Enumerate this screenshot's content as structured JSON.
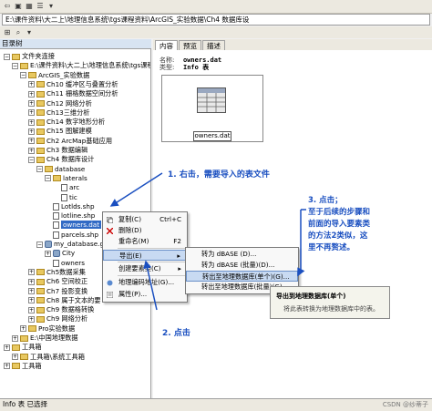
{
  "address": {
    "path": "E:\\课件资料\\大二上\\地理信息系统\\tgs课程资料\\ArcGIS_实验数据\\Ch4 数据库设"
  },
  "tree": {
    "title": "目录树",
    "items": [
      {
        "label": "文件夹连接",
        "indent": 0,
        "icon": "folder",
        "exp": "−"
      },
      {
        "label": "E:\\课件资料\\大二上\\地理信息系统\\tgs课程资",
        "indent": 1,
        "icon": "folder",
        "exp": "−"
      },
      {
        "label": "ArcGIS_实验数据",
        "indent": 2,
        "icon": "folder",
        "exp": "−"
      },
      {
        "label": "Ch10 缓冲区与叠置分析",
        "indent": 3,
        "icon": "folder",
        "exp": "+"
      },
      {
        "label": "Ch11 栅格数据空间分析",
        "indent": 3,
        "icon": "folder",
        "exp": "+"
      },
      {
        "label": "Ch12 网络分析",
        "indent": 3,
        "icon": "folder",
        "exp": "+"
      },
      {
        "label": "Ch13三维分析",
        "indent": 3,
        "icon": "folder",
        "exp": "+"
      },
      {
        "label": "Ch14 数字地形分析",
        "indent": 3,
        "icon": "folder",
        "exp": "+"
      },
      {
        "label": "Ch15 图解建模",
        "indent": 3,
        "icon": "folder",
        "exp": "+"
      },
      {
        "label": "Ch2 ArcMap基础应用",
        "indent": 3,
        "icon": "folder",
        "exp": "+"
      },
      {
        "label": "Ch3 数据编辑",
        "indent": 3,
        "icon": "folder",
        "exp": "+"
      },
      {
        "label": "Ch4 数据库设计",
        "indent": 3,
        "icon": "folder",
        "exp": "−"
      },
      {
        "label": "database",
        "indent": 4,
        "icon": "folder",
        "exp": "−"
      },
      {
        "label": "laterals",
        "indent": 5,
        "icon": "folder",
        "exp": "−"
      },
      {
        "label": "arc",
        "indent": 6,
        "icon": "file",
        "exp": ""
      },
      {
        "label": "tic",
        "indent": 6,
        "icon": "file",
        "exp": ""
      },
      {
        "label": "Lotlds.shp",
        "indent": 5,
        "icon": "file",
        "exp": ""
      },
      {
        "label": "lotline.shp",
        "indent": 5,
        "icon": "file",
        "exp": ""
      },
      {
        "label": "owners.dat",
        "indent": 5,
        "icon": "file",
        "exp": "",
        "selected": true
      },
      {
        "label": "parcels.shp",
        "indent": 5,
        "icon": "file",
        "exp": ""
      },
      {
        "label": "my_database.gdb",
        "indent": 4,
        "icon": "db",
        "exp": "−"
      },
      {
        "label": "City",
        "indent": 5,
        "icon": "db",
        "exp": "+"
      },
      {
        "label": "owners",
        "indent": 5,
        "icon": "file",
        "exp": ""
      },
      {
        "label": "Ch5数据采集",
        "indent": 3,
        "icon": "folder",
        "exp": "+"
      },
      {
        "label": "Ch6 空间校正",
        "indent": 3,
        "icon": "folder",
        "exp": "+"
      },
      {
        "label": "Ch7 投影变换",
        "indent": 3,
        "icon": "folder",
        "exp": "+"
      },
      {
        "label": "Ch8 属于文本的要",
        "indent": 3,
        "icon": "folder",
        "exp": "+"
      },
      {
        "label": "Ch9 数据格转换",
        "indent": 3,
        "icon": "folder",
        "exp": "+"
      },
      {
        "label": "Ch9 网络分析",
        "indent": 3,
        "icon": "folder",
        "exp": "+"
      },
      {
        "label": "Pro实验数据",
        "indent": 2,
        "icon": "folder",
        "exp": "+"
      },
      {
        "label": "E:\\中国地理数据",
        "indent": 1,
        "icon": "folder",
        "exp": "+"
      },
      {
        "label": "工具箱",
        "indent": 0,
        "icon": "folder",
        "exp": "+"
      },
      {
        "label": "工具箱\\系统工具箱",
        "indent": 1,
        "icon": "folder",
        "exp": "+"
      },
      {
        "label": "工具箱",
        "indent": 0,
        "icon": "folder",
        "exp": "+"
      }
    ]
  },
  "tabs": [
    {
      "label": "内容",
      "active": true
    },
    {
      "label": "预览",
      "active": false
    },
    {
      "label": "描述",
      "active": false
    }
  ],
  "content": {
    "name_label": "名称:",
    "name_value": "owners.dat",
    "type_label": "类型:",
    "type_value": "Info 表",
    "preview_caption": "owners.dat"
  },
  "context_menu": [
    {
      "label": "复制(C)",
      "shortcut": "Ctrl+C",
      "icon": "copy-icon"
    },
    {
      "label": "删除(D)",
      "shortcut": "",
      "icon": "delete-icon"
    },
    {
      "label": "重命名(M)",
      "shortcut": "F2",
      "icon": "rename-icon"
    },
    {
      "label": "导出(E)",
      "shortcut": "▸",
      "icon": "",
      "highlight": true
    },
    {
      "label": "创建要素类(C)",
      "shortcut": "▸",
      "icon": ""
    },
    {
      "label": "地理编码地址(G)...",
      "shortcut": "",
      "icon": "geocode-icon"
    },
    {
      "label": "属性(P)...",
      "shortcut": "",
      "icon": "properties-icon"
    }
  ],
  "submenu": [
    {
      "label": "转为 dBASE (D)...",
      "highlight": false
    },
    {
      "label": "转为 dBASE (批量)(D)...",
      "highlight": false
    },
    {
      "label": "转出至地理数据库(单个)(G)...",
      "highlight": true
    },
    {
      "label": "转出至地理数据库(批量)(G)...",
      "highlight": false
    }
  ],
  "tooltip": {
    "title": "导出到地理数据库(单个)",
    "body": "将此表转换为地理数据库中的表。"
  },
  "annotations": {
    "a1": "1. 右击，需要导入的表文件",
    "a2": "2. 点击",
    "a3_lines": [
      "3. 点击；",
      "至于后续的步骤和",
      "前面的导入要素类",
      "的方法2类似，这",
      "里不再赘述。"
    ]
  },
  "status": {
    "text": "Info 表 已选择"
  },
  "watermark": "CSDN @纱蒂子",
  "colors": {
    "annotation": "#1a4fc0",
    "selection": "#316ac5"
  }
}
